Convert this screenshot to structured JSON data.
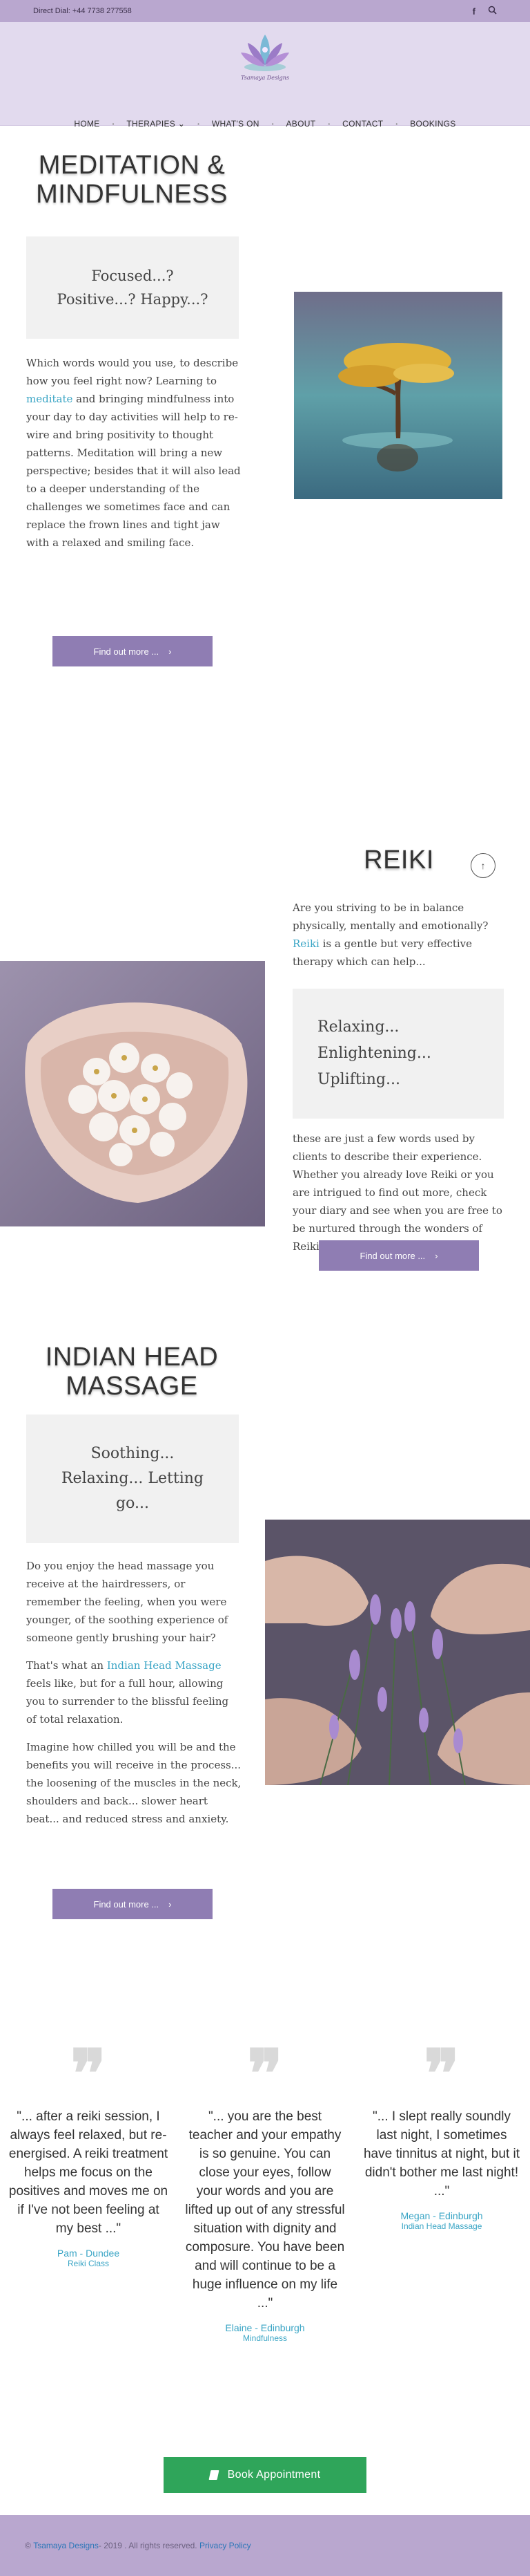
{
  "topbar": {
    "phone": "Direct Dial: +44 7738 277558",
    "facebook_icon": "f",
    "search_icon": "⌕"
  },
  "logo": {
    "text": "Tsamaya Designs"
  },
  "nav": [
    {
      "label": "HOME"
    },
    {
      "label": "THERAPIES ⌄"
    },
    {
      "label": "WHAT'S ON"
    },
    {
      "label": "ABOUT"
    },
    {
      "label": "CONTACT"
    },
    {
      "label": "BOOKINGS"
    }
  ],
  "meditation": {
    "title_line1": "MEDITATION &",
    "title_line2": "MINDFULNESS",
    "quote_line1": "Focused...?",
    "quote_line2": "Positive...? Happy...?",
    "p1_before": "Which words would you use, to describe how you feel right now? Learning to ",
    "p1_link": "meditate",
    "p1_after": " and bringing mindfulness into your day to day activities will help to re-wire and bring positivity to thought patterns. Meditation will bring a new perspective; besides that it will also lead to a deeper understanding of the challenges we sometimes face and can replace the frown lines and tight jaw with a relaxed and smiling face.",
    "button": "Find out more ...",
    "button_icon": "›"
  },
  "reiki": {
    "title": "REIKI",
    "scroll_top_icon": "↑",
    "p1_before": "Are you striving to be in balance physically, mentally and emotionally? ",
    "p1_link": "Reiki",
    "p1_after": " is a gentle but very effective therapy which can help...",
    "quote_line1": "Relaxing...",
    "quote_line2": "Enlightening...",
    "quote_line3": "Uplifting...",
    "p2": "these are just a few words used by clients to describe their experience. Whether you already love Reiki or you are intrigued to find out more, check your diary and see when you are free to be nurtured through the wonders of Reiki.",
    "button": "Find out more ...",
    "button_icon": "›"
  },
  "ihm": {
    "title_line1": "INDIAN HEAD",
    "title_line2": "MASSAGE",
    "quote_line1": "Soothing...",
    "quote_line2": "Relaxing... Letting",
    "quote_line3": "go...",
    "p1": "Do you enjoy the head massage you receive at the hairdressers, or remember the feeling, when you were younger, of the soothing experience of someone gently brushing your hair?",
    "p2_before": "That's what an ",
    "p2_link": "Indian Head Massage",
    "p2_after": " feels like, but for a full hour, allowing you to surrender to the blissful feeling of total relaxation.",
    "p3": "Imagine how chilled you will be and the benefits you will receive in the process... the loosening of the muscles in the neck, shoulders and back... slower heart beat... and reduced stress and anxiety.",
    "button": "Find out more ...",
    "button_icon": "›"
  },
  "testimonials": [
    {
      "text": "\"... after a reiki session, I always feel relaxed, but re-energised. A reiki treatment helps me focus on the positives and moves me on if I've not been feeling at my best ...\"",
      "name": "Pam - Dundee",
      "service": "Reiki Class"
    },
    {
      "text": "\"... you are the best teacher and your empathy is so genuine. You can close your eyes, follow your words and you are lifted up out of any stressful situation with dignity and composure. You have been and will continue to be a huge influence on my life ...\"",
      "name": "Elaine - Edinburgh",
      "service": "Mindfulness"
    },
    {
      "text": "\"... I slept really soundly last night, I sometimes have tinnitus at night, but it didn't bother me last night! ...\"",
      "name": "Megan - Edinburgh",
      "service": "Indian Head Massage"
    }
  ],
  "quote_glyph": "❞",
  "book": {
    "label": "Book Appointment",
    "icon": "▮"
  },
  "footer": {
    "copyright": "©",
    "company": "Tsamaya Designs",
    "rights": " - 2019 . All rights reserved.",
    "privacy": "Privacy Policy"
  },
  "colors": {
    "lilac": "#b9a7cf",
    "light_lilac": "#e2daee",
    "button": "#8f7db3",
    "link": "#3aa5c5",
    "book": "#2fa55a"
  }
}
